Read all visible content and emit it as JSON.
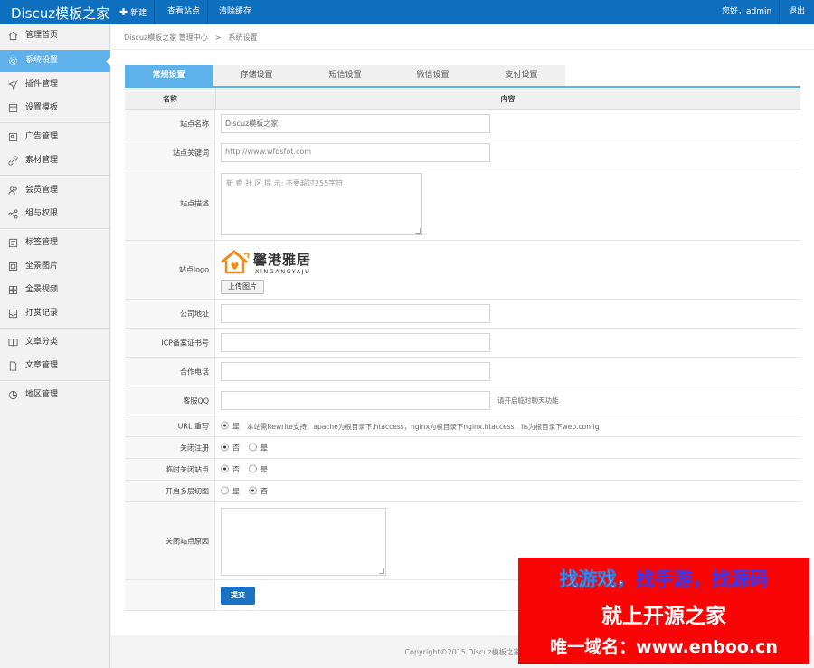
{
  "topbar": {
    "brand": "Discuz模板之家",
    "new_label": "新建",
    "view_site": "查看站点",
    "clear_cache": "清除缓存",
    "greeting": "您好，admin",
    "logout": "退出",
    "bg_color": "#0e6fbf"
  },
  "sidebar": {
    "items": [
      {
        "label": "管理首页",
        "icon": "home-icon"
      },
      {
        "label": "系统设置",
        "icon": "gear-icon",
        "active": true
      },
      {
        "label": "插件管理",
        "icon": "send-icon"
      },
      {
        "label": "设置模板",
        "icon": "template-icon"
      },
      {
        "label": "广告管理",
        "icon": "ad-icon"
      },
      {
        "label": "素材管理",
        "icon": "link-icon"
      },
      {
        "label": "会员管理",
        "icon": "users-icon"
      },
      {
        "label": "组与权限",
        "icon": "share-icon"
      },
      {
        "label": "标签管理",
        "icon": "tag-list-icon"
      },
      {
        "label": "全景图片",
        "icon": "panorama-image-icon"
      },
      {
        "label": "全景视频",
        "icon": "grid-icon"
      },
      {
        "label": "打赏记录",
        "icon": "inbox-icon"
      },
      {
        "label": "文章分类",
        "icon": "book-icon"
      },
      {
        "label": "文章管理",
        "icon": "file-icon"
      },
      {
        "label": "地区管理",
        "icon": "region-icon"
      }
    ],
    "active_color": "#5fb1ec"
  },
  "breadcrumb": {
    "root": "Discuz模板之家 管理中心",
    "separator": ">",
    "current": "系统设置"
  },
  "tabs": [
    "常规设置",
    "存储设置",
    "短信设置",
    "微信设置",
    "支付设置"
  ],
  "table_header": {
    "name": "名称",
    "content": "内容"
  },
  "form": {
    "site_name": {
      "label": "站点名称",
      "value": "Discuz模板之家"
    },
    "site_keywords": {
      "label": "站点关键词",
      "value": "http://www.wfdsfot.com"
    },
    "site_description": {
      "label": "站点描述",
      "placeholder": "新 睿 社 区 提 示: 不要超过255字符"
    },
    "site_logo": {
      "label": "站点logo",
      "logo_text_cn": "馨港雅居",
      "logo_text_en": "XINGANGYAJU",
      "upload_label": "上传图片"
    },
    "company_address": {
      "label": "公司地址",
      "value": ""
    },
    "icp": {
      "label": "ICP备案证书号",
      "value": ""
    },
    "phone": {
      "label": "合作电话",
      "value": ""
    },
    "qq": {
      "label": "客服QQ",
      "value": "",
      "hint": "请开启临时聊天功能"
    },
    "url_rewrite": {
      "label": "URL 重写",
      "option": "是",
      "hint": "本站需Rewrite支持，apache为根目录下.htaccess，nginx为根目录下nginx.htaccess，iis为根目录下web.config"
    },
    "close_register": {
      "label": "关闭注册",
      "options": [
        "否",
        "是"
      ],
      "selected": "否"
    },
    "temp_close": {
      "label": "临时关闭站点",
      "options": [
        "否",
        "是"
      ],
      "selected": "否"
    },
    "multi_level": {
      "label": "开启多层切图",
      "options": [
        "是",
        "否"
      ],
      "selected": "否"
    },
    "close_reason": {
      "label": "关闭站点原因",
      "value": ""
    },
    "submit_label": "提交"
  },
  "footer": "Copyright©2015   Discuz模板之家",
  "watermark": {
    "line1_a": "找游戏，",
    "line1_b": "找手游，",
    "line1_c": "找源码",
    "line2": "就上开源之家",
    "line3": "唯一域名：www.enboo.cn",
    "bg_color": "#fa0505"
  }
}
